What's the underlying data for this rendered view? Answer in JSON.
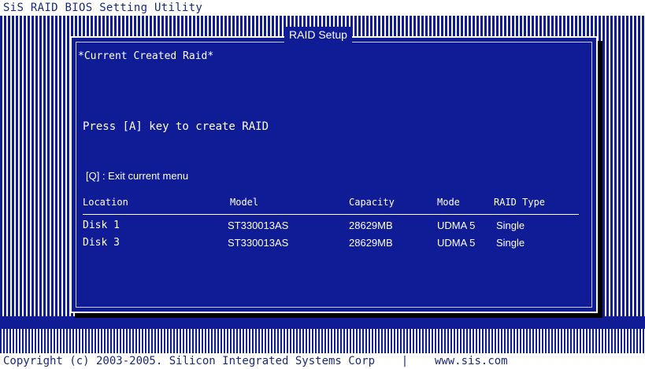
{
  "app": {
    "title": "SiS RAID BIOS Setting Utility"
  },
  "dialog": {
    "title": "RAID Setup",
    "section_label": "*Current Created Raid*",
    "instruction": "Press [A] key to create RAID",
    "exit_hint": "[Q] : Exit current menu"
  },
  "table": {
    "headers": {
      "location": "Location",
      "model": "Model",
      "capacity": "Capacity",
      "mode": "Mode",
      "raid_type": "RAID Type"
    },
    "rows": [
      {
        "location": "Disk 1",
        "model": "ST330013AS",
        "capacity": "28629MB",
        "mode": "UDMA 5",
        "raid_type": "Single"
      },
      {
        "location": "Disk 3",
        "model": "ST330013AS",
        "capacity": "28629MB",
        "mode": "UDMA 5",
        "raid_type": "Single"
      }
    ]
  },
  "footer": {
    "copyright": "Copyright (c) 2003-2005. Silicon Integrated Systems Corp",
    "separator": "|",
    "website": "www.sis.com"
  },
  "colors": {
    "background_blue": "#0f1c96",
    "text": "#ffffff",
    "header_text": "#1a2a7a"
  }
}
